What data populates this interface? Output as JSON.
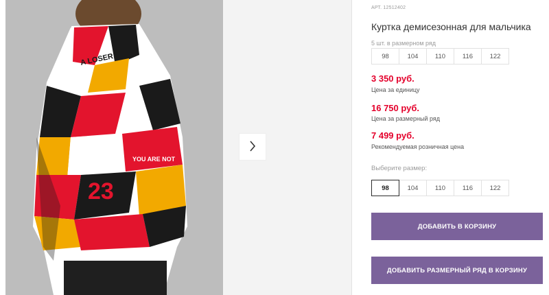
{
  "gallery": {
    "next_icon": "chevron-right-icon"
  },
  "product": {
    "sku": "АРТ. 12512402",
    "title": "Куртка демисезонная для мальчика",
    "pack_note": "5 шт. в размерном ряд",
    "pack_sizes": [
      "98",
      "104",
      "110",
      "116",
      "122"
    ],
    "prices": [
      {
        "value": "3 350 руб.",
        "label": "Цена за единицу"
      },
      {
        "value": "16 750 руб.",
        "label": "Цена за размерный ряд"
      },
      {
        "value": "7 499 руб.",
        "label": "Рекомендуемая розничная цена"
      }
    ],
    "choose_size_label": "Выберите размер:",
    "sizes": [
      "98",
      "104",
      "110",
      "116",
      "122"
    ],
    "selected_size": "98",
    "add_to_cart": "Добавить в корзину",
    "add_pack_to_cart": "Добавить размерный ряд в корзину"
  },
  "colors": {
    "price": "#e4002b",
    "button": "#7b629b"
  }
}
